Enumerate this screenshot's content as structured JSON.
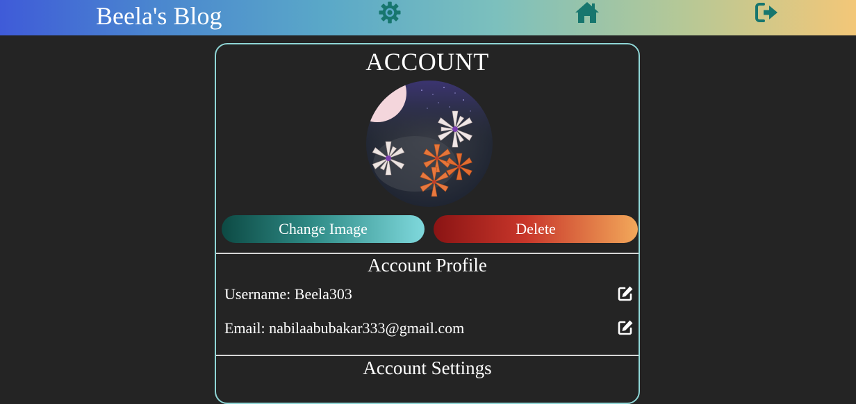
{
  "navbar": {
    "brand": "Beela's Blog",
    "icons": [
      "gear-icon",
      "home-icon",
      "logout-icon"
    ],
    "icon_color": "#17766e"
  },
  "account": {
    "title": "ACCOUNT",
    "buttons": {
      "change_image": "Change Image",
      "delete": "Delete"
    },
    "profile": {
      "title": "Account Profile",
      "username_label": "Username: Beela303",
      "email_label": "Email: nabilaabubakar333@gmail.com"
    },
    "settings": {
      "title": "Account Settings"
    }
  },
  "colors": {
    "page_background": "#242424",
    "card_border": "#8fd6d6",
    "change_button": [
      "#0d4a44",
      "#7fd8dc"
    ],
    "delete_button": [
      "#8a1414",
      "#f2a85a"
    ]
  }
}
